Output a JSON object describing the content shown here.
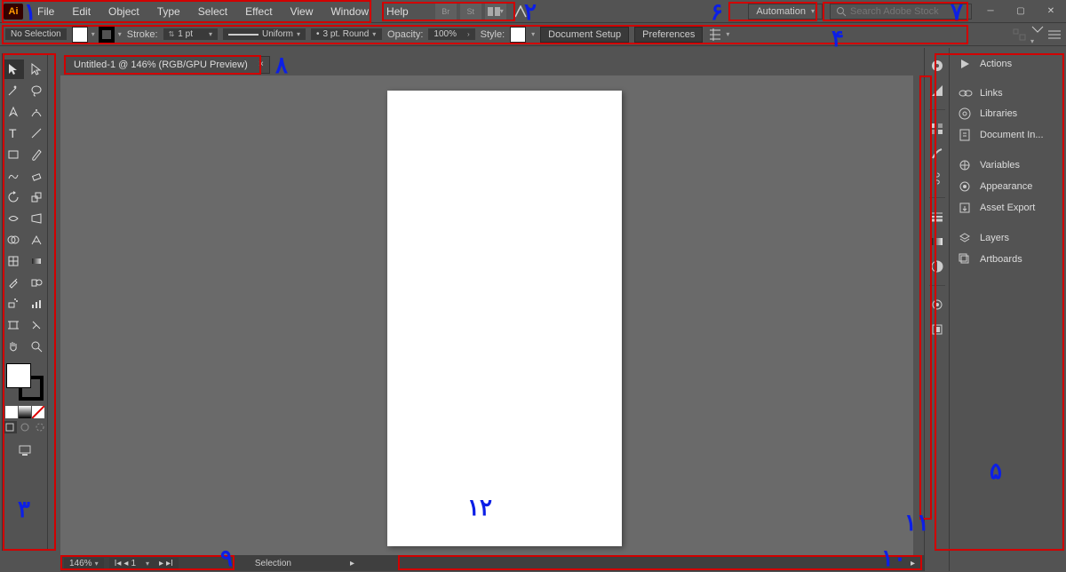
{
  "app_logo": "Ai",
  "menu": [
    "File",
    "Edit",
    "Object",
    "Type",
    "Select",
    "Effect",
    "View",
    "Window",
    "Help"
  ],
  "top_center_btns": [
    "Br",
    "St"
  ],
  "workspace_dropdown": "Automation",
  "search_placeholder": "Search Adobe Stock",
  "ctrl": {
    "no_selection": "No Selection",
    "stroke_label": "Stroke:",
    "stroke_val": "1 pt",
    "profile": "Uniform",
    "brush": "3 pt. Round",
    "opacity_label": "Opacity:",
    "opacity_val": "100%",
    "style_label": "Style:",
    "doc_setup": "Document Setup",
    "prefs": "Preferences"
  },
  "doc_tab": "Untitled-1 @ 146% (RGB/GPU Preview)",
  "panels": [
    "Actions",
    "Links",
    "Libraries",
    "Document In...",
    "Variables",
    "Appearance",
    "Asset Export",
    "Layers",
    "Artboards"
  ],
  "status": {
    "zoom": "146%",
    "artboard_idx": "1",
    "tool": "Selection"
  },
  "annotations": [
    "١",
    "٢",
    "٣",
    "۴",
    "۵",
    "۶",
    "٧",
    "٨",
    "٩",
    "١٠",
    "١١",
    "١٢"
  ]
}
